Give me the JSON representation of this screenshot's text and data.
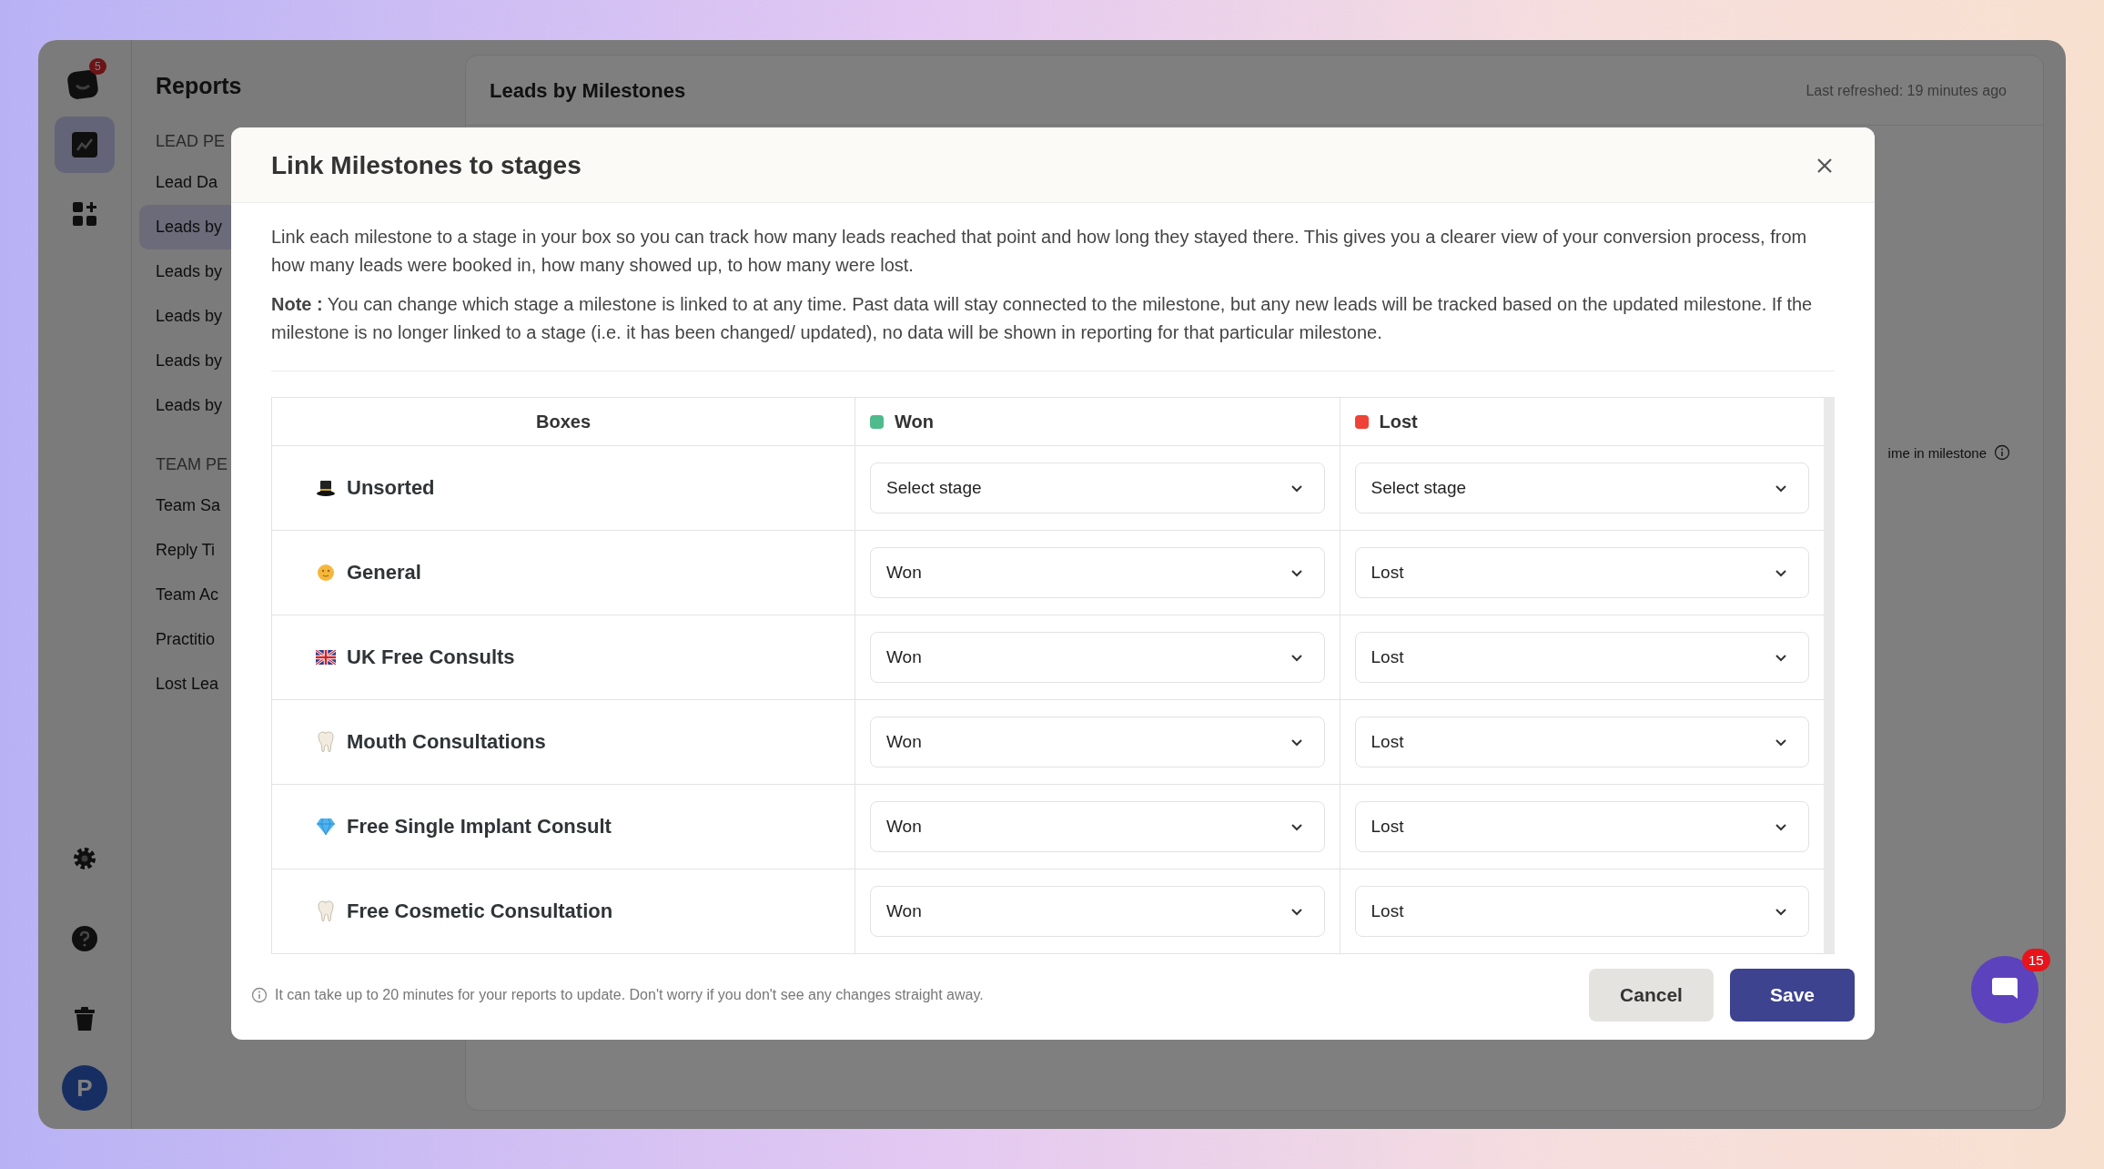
{
  "app": {
    "notification_badge": "5",
    "avatar_initial": "P"
  },
  "nav": [
    {
      "kind": "chart",
      "selected": true
    },
    {
      "kind": "apps",
      "selected": false
    }
  ],
  "reports_panel": {
    "title": "Reports",
    "sections": [
      {
        "heading": "LEAD PE",
        "items": [
          {
            "label": "Lead Da",
            "selected": false
          },
          {
            "label": "Leads by",
            "selected": true
          },
          {
            "label": "Leads by",
            "selected": false
          },
          {
            "label": "Leads by",
            "selected": false
          },
          {
            "label": "Leads by",
            "selected": false
          },
          {
            "label": "Leads by",
            "selected": false
          }
        ]
      },
      {
        "heading": "TEAM PE",
        "items": [
          {
            "label": "Team Sa",
            "selected": false
          },
          {
            "label": "Reply Ti",
            "selected": false
          },
          {
            "label": "Team Ac",
            "selected": false
          },
          {
            "label": "Practitio",
            "selected": false
          },
          {
            "label": "Lost Lea",
            "selected": false
          }
        ]
      }
    ]
  },
  "main": {
    "title": "Leads by Milestones",
    "last_refreshed": "Last refreshed: 19 minutes ago",
    "column_label": "ime in milestone"
  },
  "modal": {
    "title": "Link Milestones to stages",
    "description": "Link each milestone to a stage in your box so you can track how many leads reached that point and how long they stayed there. This gives you a clearer view of your conversion process, from how many leads were booked in, how many showed up, to how many were lost.",
    "note": "**Note :** You can change which stage a milestone is linked to at any time. Past data will stay connected to the milestone, but any new leads will be tracked based on the updated milestone. If the milestone is no longer linked to a stage (i.e. it has been changed/ updated), no data will be shown in reporting for that particular milestone.",
    "columns": [
      {
        "label": "Boxes"
      },
      {
        "label": "Won",
        "color": "#4fba8c"
      },
      {
        "label": "Lost",
        "color": "#ee4336"
      }
    ],
    "rows": [
      {
        "name": "Unsorted",
        "kind": "hat",
        "won": "Select stage",
        "lost": "Select stage"
      },
      {
        "name": "General",
        "kind": "sun",
        "won": "Won",
        "lost": "Lost"
      },
      {
        "name": "UK Free Consults",
        "kind": "flag",
        "won": "Won",
        "lost": "Lost"
      },
      {
        "name": "Mouth Consultations",
        "kind": "tooth",
        "won": "Won",
        "lost": "Lost"
      },
      {
        "name": "Free Single Implant Consult",
        "kind": "gem",
        "won": "Won",
        "lost": "Lost"
      },
      {
        "name": "Free Cosmetic Consultation",
        "kind": "tooth",
        "won": "Won",
        "lost": "Lost"
      }
    ],
    "footer_note": "It can take up to 20 minutes for your reports to update. Don't worry if you don't see any changes straight away.",
    "buttons": [
      "Cancel",
      "Save"
    ]
  },
  "chat": {
    "badge": "15"
  }
}
